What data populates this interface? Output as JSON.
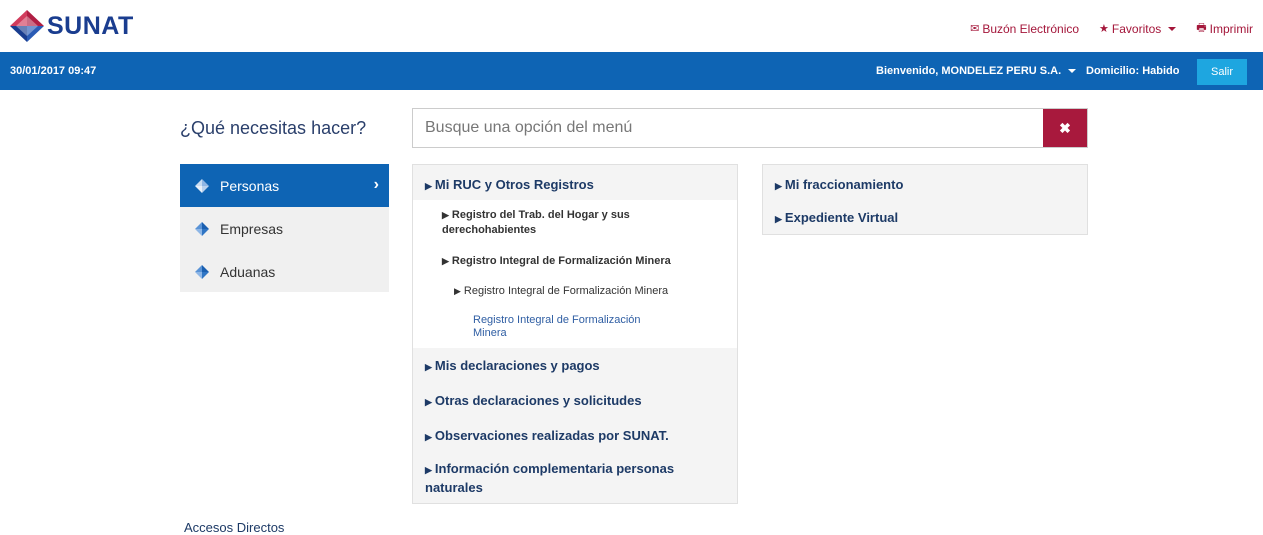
{
  "header": {
    "logo_text": "SUNAT",
    "links": [
      {
        "icon": "envelope-icon",
        "label": "Buzón Electrónico"
      },
      {
        "icon": "star-icon",
        "label": "Favoritos"
      },
      {
        "icon": "printer-icon",
        "label": "Imprimir"
      }
    ]
  },
  "bar": {
    "datetime": "30/01/2017 09:47",
    "welcome": "Bienvenido, MONDELEZ PERU S.A.",
    "domicilio": "Domicilio: Habido",
    "logout": "Salir"
  },
  "search": {
    "question": "¿Qué necesitas hacer?",
    "placeholder": "Busque una opción del menú",
    "clear": "✖"
  },
  "nav": {
    "items": [
      {
        "label": "Personas",
        "active": true
      },
      {
        "label": "Empresas",
        "active": false
      },
      {
        "label": "Aduanas",
        "active": false
      }
    ]
  },
  "menu": {
    "sections": [
      "Mi RUC y Otros Registros",
      "Mis declaraciones y pagos",
      "Otras declaraciones y solicitudes",
      "Observaciones realizadas por SUNAT.",
      "Información complementaria personas naturales"
    ],
    "sub1": "Registro del Trab. del Hogar y sus derechohabientes",
    "sub2": "Registro Integral de Formalización Minera",
    "sub3": "Registro Integral de Formalización Minera",
    "leaf": "Registro Integral de Formalización Minera",
    "right": [
      "Mi fraccionamiento",
      "Expediente Virtual"
    ]
  },
  "footer": {
    "accesos": "Accesos Directos"
  },
  "colors": {
    "brand_blue": "#0e64b4",
    "accent_red": "#a8193d",
    "salir_button": "#1ea6e0"
  }
}
